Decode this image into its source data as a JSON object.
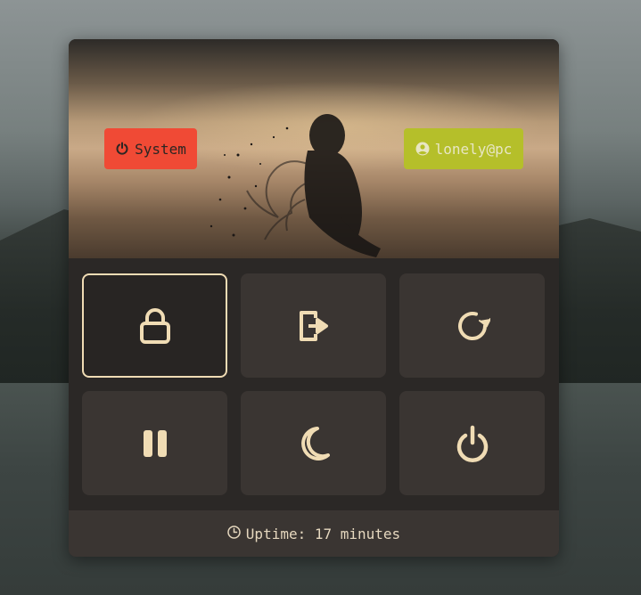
{
  "header": {
    "system_label": "System",
    "user_label": "lonely@pc"
  },
  "actions": [
    {
      "id": "lock",
      "icon": "lock-icon",
      "active": true
    },
    {
      "id": "logout",
      "icon": "logout-icon",
      "active": false
    },
    {
      "id": "reboot",
      "icon": "reboot-icon",
      "active": false
    },
    {
      "id": "suspend",
      "icon": "pause-icon",
      "active": false
    },
    {
      "id": "hibernate",
      "icon": "moon-icon",
      "active": false
    },
    {
      "id": "shutdown",
      "icon": "power-icon",
      "active": false
    }
  ],
  "footer": {
    "uptime_text": "Uptime: 17 minutes"
  },
  "colors": {
    "accent_red": "#f04a35",
    "accent_green": "#b5bf2a",
    "icon_cream": "#f0dcb4",
    "tile_bg": "#3a3532"
  }
}
